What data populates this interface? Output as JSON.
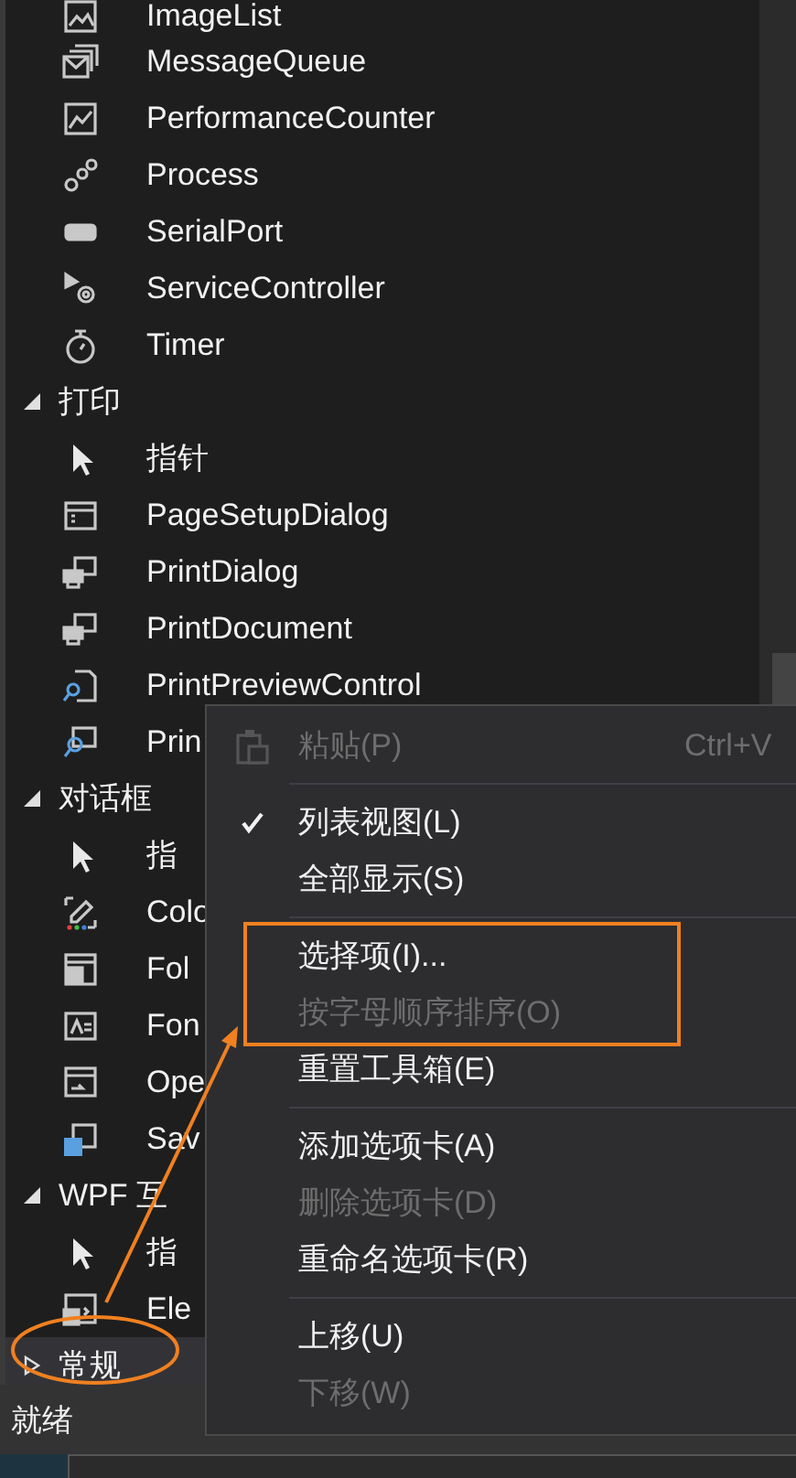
{
  "toolbox": {
    "items": [
      {
        "kind": "item",
        "label": "ImageList",
        "selected": false
      },
      {
        "kind": "item",
        "label": "MessageQueue",
        "selected": false
      },
      {
        "kind": "item",
        "label": "PerformanceCounter",
        "selected": false
      },
      {
        "kind": "item",
        "label": "Process",
        "selected": false
      },
      {
        "kind": "item",
        "label": "SerialPort",
        "selected": false
      },
      {
        "kind": "item",
        "label": "ServiceController",
        "selected": false
      },
      {
        "kind": "item",
        "label": "Timer",
        "selected": false
      },
      {
        "kind": "group",
        "label": "打印",
        "expanded": true,
        "selected": false,
        "children": [
          {
            "kind": "item",
            "label": "指针",
            "selected": false
          },
          {
            "kind": "item",
            "label": "PageSetupDialog",
            "selected": false
          },
          {
            "kind": "item",
            "label": "PrintDialog",
            "selected": false
          },
          {
            "kind": "item",
            "label": "PrintDocument",
            "selected": false
          },
          {
            "kind": "item",
            "label": "PrintPreviewControl",
            "selected": false
          },
          {
            "kind": "item",
            "label": "Prin",
            "selected": false
          }
        ]
      },
      {
        "kind": "group",
        "label": "对话框",
        "expanded": true,
        "selected": false,
        "children": [
          {
            "kind": "item",
            "label": "指",
            "selected": false
          },
          {
            "kind": "item",
            "label": "Colo",
            "selected": false
          },
          {
            "kind": "item",
            "label": "Fol",
            "selected": false
          },
          {
            "kind": "item",
            "label": "Fon",
            "selected": false
          },
          {
            "kind": "item",
            "label": "Ope",
            "selected": false
          },
          {
            "kind": "item",
            "label": "Sav",
            "selected": false
          }
        ]
      },
      {
        "kind": "group",
        "label": "WPF 互",
        "expanded": true,
        "selected": false,
        "children": [
          {
            "kind": "item",
            "label": "指",
            "selected": false
          },
          {
            "kind": "item",
            "label": "Ele",
            "selected": false
          }
        ]
      },
      {
        "kind": "group",
        "label": "常规",
        "expanded": false,
        "selected": true
      }
    ]
  },
  "context_menu": {
    "items": [
      {
        "kind": "item",
        "label": "粘贴(P)",
        "shortcut": "Ctrl+V",
        "disabled": true,
        "checked": false
      },
      {
        "kind": "separator"
      },
      {
        "kind": "item",
        "label": "列表视图(L)",
        "disabled": false,
        "checked": true
      },
      {
        "kind": "item",
        "label": "全部显示(S)",
        "disabled": false,
        "checked": false
      },
      {
        "kind": "separator"
      },
      {
        "kind": "item",
        "label": "选择项(I)...",
        "disabled": false,
        "checked": false
      },
      {
        "kind": "item",
        "label": "按字母顺序排序(O)",
        "disabled": true,
        "checked": false
      },
      {
        "kind": "item",
        "label": "重置工具箱(E)",
        "disabled": false,
        "checked": false
      },
      {
        "kind": "separator"
      },
      {
        "kind": "item",
        "label": "添加选项卡(A)",
        "disabled": false,
        "checked": false
      },
      {
        "kind": "item",
        "label": "删除选项卡(D)",
        "disabled": true,
        "checked": false
      },
      {
        "kind": "item",
        "label": "重命名选项卡(R)",
        "disabled": false,
        "checked": false
      },
      {
        "kind": "separator"
      },
      {
        "kind": "item",
        "label": "上移(U)",
        "disabled": false,
        "checked": false
      },
      {
        "kind": "item",
        "label": "下移(W)",
        "disabled": true,
        "checked": false
      }
    ]
  },
  "annotations": [
    {
      "kind": "box"
    },
    {
      "kind": "ellipse"
    },
    {
      "kind": "arrow"
    }
  ],
  "status_bar": {
    "text": "就绪"
  }
}
